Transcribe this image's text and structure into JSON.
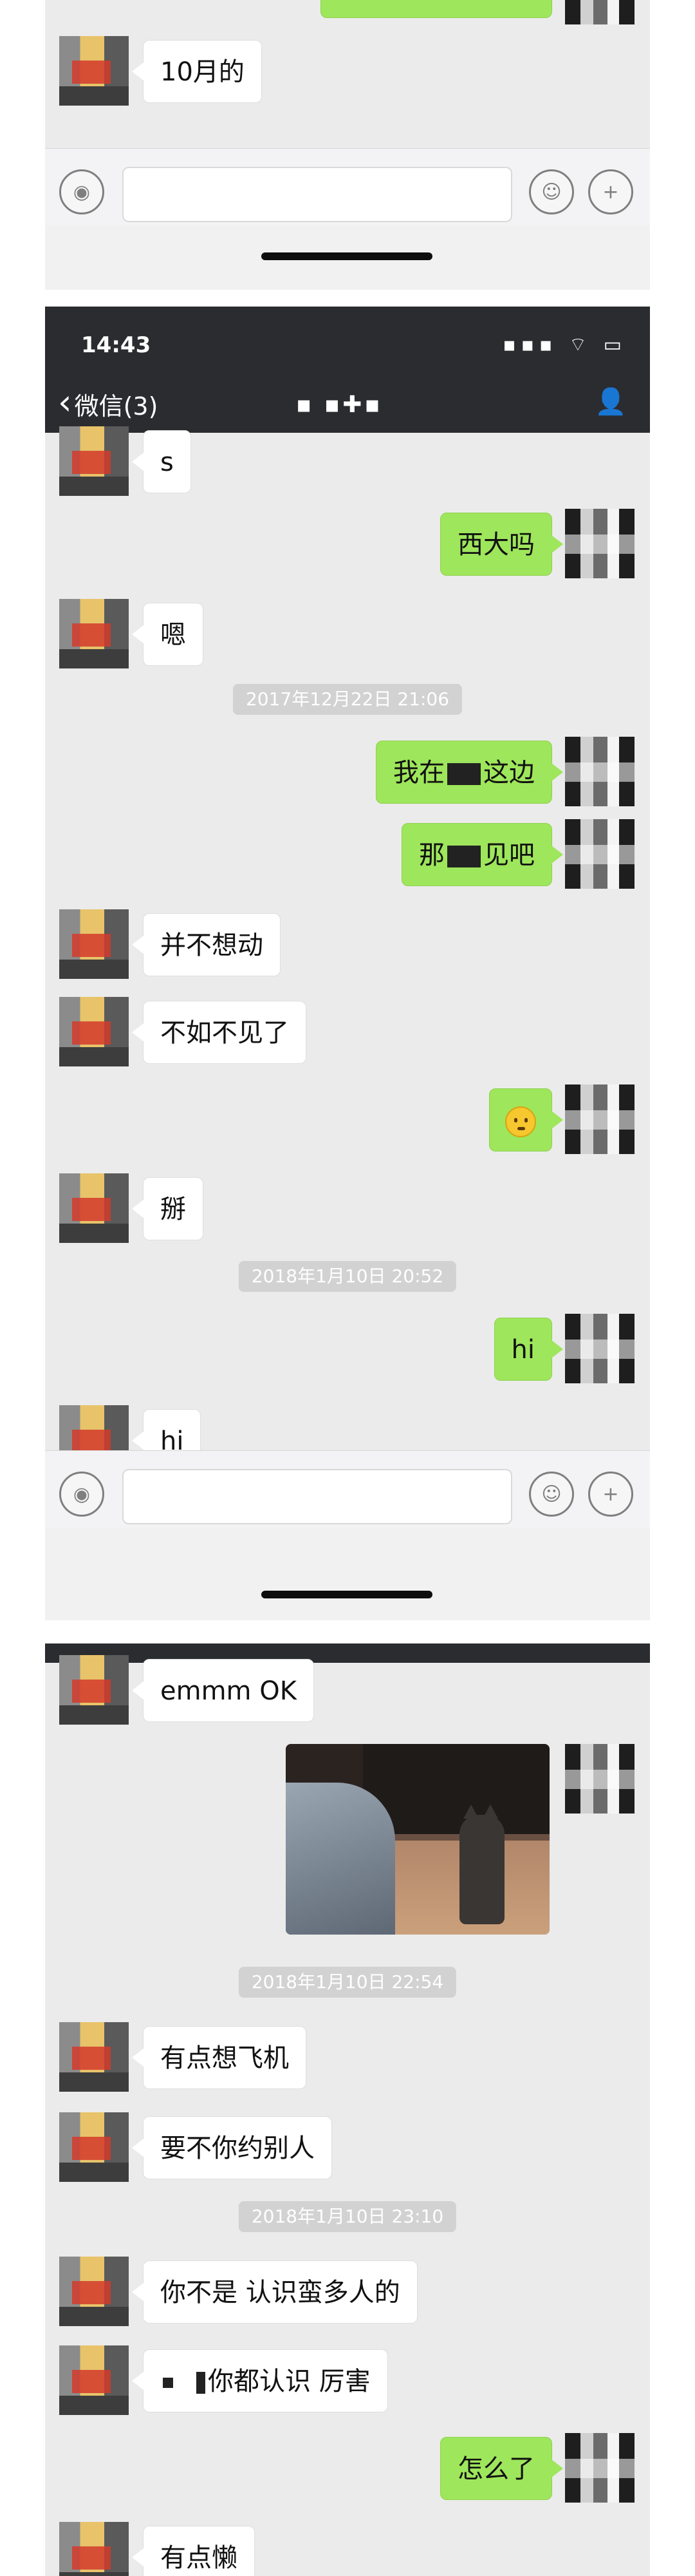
{
  "screen1": {
    "messages": [
      {
        "side": "left",
        "text": "10月的"
      }
    ]
  },
  "screen2": {
    "status": {
      "time": "14:43",
      "icons": "▪▪▪ ⌔ ▭"
    },
    "nav": {
      "back_label": "微信(3)",
      "title": "▪ ▪✚▪"
    },
    "messages": [
      {
        "side": "left",
        "text": "s"
      },
      {
        "side": "right",
        "text": "西大吗"
      },
      {
        "side": "left",
        "text": "嗯"
      },
      {
        "timestamp": "2017年12月22日 21:06"
      },
      {
        "side": "right",
        "text_a": "我在",
        "text_b": "这边"
      },
      {
        "side": "right",
        "text_a": "那",
        "text_b": "见吧"
      },
      {
        "side": "left",
        "text": "并不想动"
      },
      {
        "side": "left",
        "text": "不如不见了"
      },
      {
        "side": "right",
        "emoji": "slightly-smiling-face"
      },
      {
        "side": "left",
        "text": "掰"
      },
      {
        "timestamp": "2018年1月10日 20:52"
      },
      {
        "side": "right",
        "text": "hi"
      },
      {
        "side": "left",
        "text": "hi"
      }
    ]
  },
  "screen3": {
    "messages": [
      {
        "side": "left",
        "text": "emmm OK"
      },
      {
        "side": "right",
        "image": "photo-cat-on-floor"
      },
      {
        "timestamp": "2018年1月10日 22:54"
      },
      {
        "side": "left",
        "text": "有点想飞机"
      },
      {
        "side": "left",
        "text": "要不你约别人"
      },
      {
        "timestamp": "2018年1月10日 23:10"
      },
      {
        "side": "left",
        "text": "你不是 认识蛮多人的"
      },
      {
        "side": "left",
        "text_a": "",
        "text_b": "你都认识 厉害"
      },
      {
        "side": "right",
        "text": "怎么了"
      },
      {
        "side": "left",
        "text": "有点懒"
      }
    ]
  },
  "icons": {
    "voice": "🔊",
    "emoji": "☺",
    "plus": "+"
  }
}
